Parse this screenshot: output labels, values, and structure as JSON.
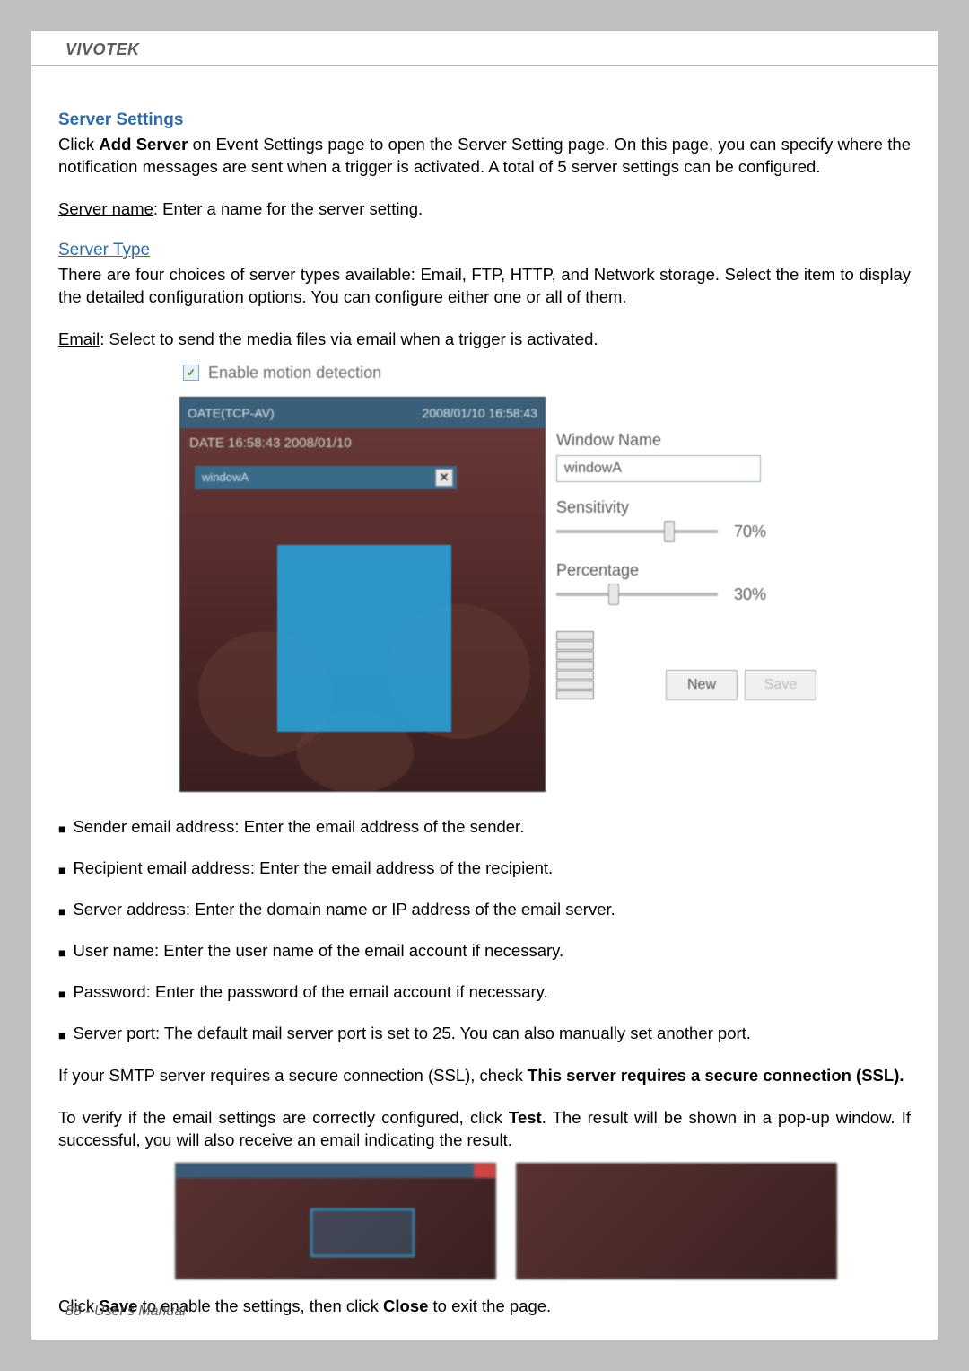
{
  "header": {
    "brand": "VIVOTEK"
  },
  "section": {
    "heading": "Server Settings",
    "intro_before": "Click ",
    "intro_bold": "Add Server",
    "intro_after": " on Event Settings page to open the Server Setting page. On this page, you can specify where the notification messages are sent when a trigger is activated. A total of 5 server settings can be configured.",
    "servername_label": "Server name",
    "servername_text": ": Enter a name for the server setting."
  },
  "servertype": {
    "heading": "Server Type",
    "para": "There are four choices of server types available: Email, FTP, HTTP, and Network storage. Select the item to display the detailed configuration options. You can configure either one or all of them.",
    "email_label": "Email",
    "email_text": ": Select to send the media files via email when a trigger is activated."
  },
  "motion_ui": {
    "enable_label": "Enable motion detection",
    "preview_title": "OATE(TCP-AV)",
    "preview_time": "2008/01/10 16:58:43",
    "preview_overlay": "DATE 16:58:43 2008/01/10",
    "sel_label": "windowA",
    "window_name_label": "Window Name",
    "window_name_value": "windowA",
    "sensitivity_label": "Sensitivity",
    "sensitivity_value": "70%",
    "percentage_label": "Percentage",
    "percentage_value": "30%",
    "new_btn": "New",
    "save_btn": "Save"
  },
  "bullets": [
    "Sender email address: Enter the email address of the sender.",
    "Recipient email address: Enter the email address of the recipient.",
    "Server address: Enter the domain name or IP address of the email server.",
    "User name: Enter the user name of the email account if necessary.",
    "Password: Enter the password of the email account if necessary.",
    "Server port: The default mail server port is set to 25. You can also manually set another port."
  ],
  "ssl": {
    "before": "If your SMTP server requires a secure connection (SSL), check ",
    "bold": "This server requires a secure connection (SSL)."
  },
  "verify": {
    "before": "To verify if the email settings are correctly configured, click ",
    "bold": "Test",
    "after": ". The result will be shown in a pop-up window. If successful, you will also receive an email indicating the result."
  },
  "final": {
    "t1": "Click ",
    "b1": "Save",
    "t2": " to enable the settings, then click ",
    "b2": "Close",
    "t3": " to exit the page."
  },
  "footer": {
    "page": "88 - User's Manual"
  }
}
